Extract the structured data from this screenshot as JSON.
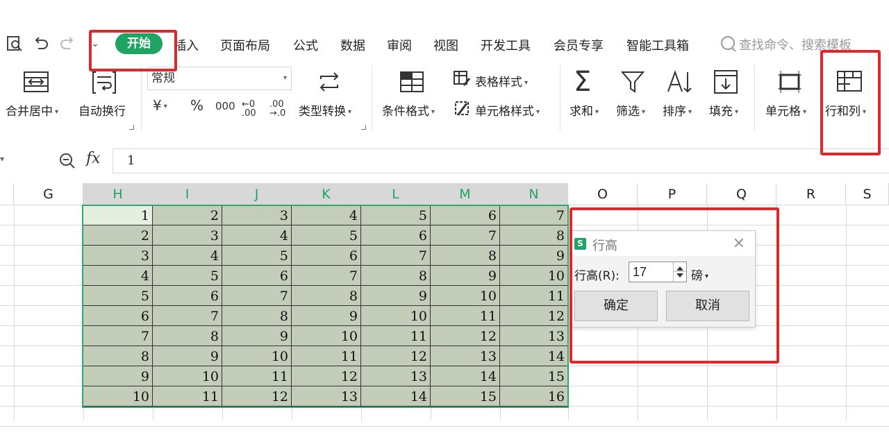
{
  "quick_access": {
    "preview_icon": "print-preview-icon",
    "undo_icon": "undo-icon",
    "redo_icon": "redo-icon",
    "more_icon": "chevron-down-icon"
  },
  "menu": {
    "active_tab": "开始",
    "tabs": [
      "插入",
      "页面布局",
      "公式",
      "数据",
      "审阅",
      "视图",
      "开发工具",
      "会员专享",
      "智能工具箱"
    ],
    "search_placeholder": "查找命令、搜索模板"
  },
  "ribbon": {
    "merge_center": "合并居中",
    "wrap_text": "自动换行",
    "number_format": "常规",
    "currency": "¥",
    "percent": "%",
    "thousands": "000",
    "inc_decimal": "←0 .00",
    "dec_decimal": ".00 →.0",
    "type_convert": "类型转换",
    "conditional_format": "条件格式",
    "table_style": "表格样式",
    "cell_style": "单元格样式",
    "sum": "求和",
    "filter": "筛选",
    "sort": "排序",
    "fill": "填充",
    "cell": "单元格",
    "row_col": "行和列"
  },
  "formula_bar": {
    "fx": "fx",
    "value": "1"
  },
  "columns": [
    "G",
    "H",
    "I",
    "J",
    "K",
    "L",
    "M",
    "N",
    "O",
    "P",
    "Q",
    "R",
    "S"
  ],
  "selected_columns": [
    "H",
    "I",
    "J",
    "K",
    "L",
    "M",
    "N"
  ],
  "grid": [
    [
      "1",
      "2",
      "3",
      "4",
      "5",
      "6",
      "7"
    ],
    [
      "2",
      "3",
      "4",
      "5",
      "6",
      "7",
      "8"
    ],
    [
      "3",
      "4",
      "5",
      "6",
      "7",
      "8",
      "9"
    ],
    [
      "4",
      "5",
      "6",
      "7",
      "8",
      "9",
      "10"
    ],
    [
      "5",
      "6",
      "7",
      "8",
      "9",
      "10",
      "11"
    ],
    [
      "6",
      "7",
      "8",
      "9",
      "10",
      "11",
      "12"
    ],
    [
      "7",
      "8",
      "9",
      "10",
      "11",
      "12",
      "13"
    ],
    [
      "8",
      "9",
      "10",
      "11",
      "12",
      "13",
      "14"
    ],
    [
      "9",
      "10",
      "11",
      "12",
      "13",
      "14",
      "15"
    ],
    [
      "10",
      "11",
      "12",
      "13",
      "14",
      "15",
      "16"
    ]
  ],
  "dialog": {
    "logo": "S",
    "title": "行高",
    "label": "行高(R):",
    "value": "17",
    "unit": "磅",
    "ok": "确定",
    "cancel": "取消",
    "close_icon": "close-icon"
  },
  "colors": {
    "accent": "#1fa463",
    "selection_fill": "#c3cdb9",
    "annotation_red": "#e0272b"
  }
}
